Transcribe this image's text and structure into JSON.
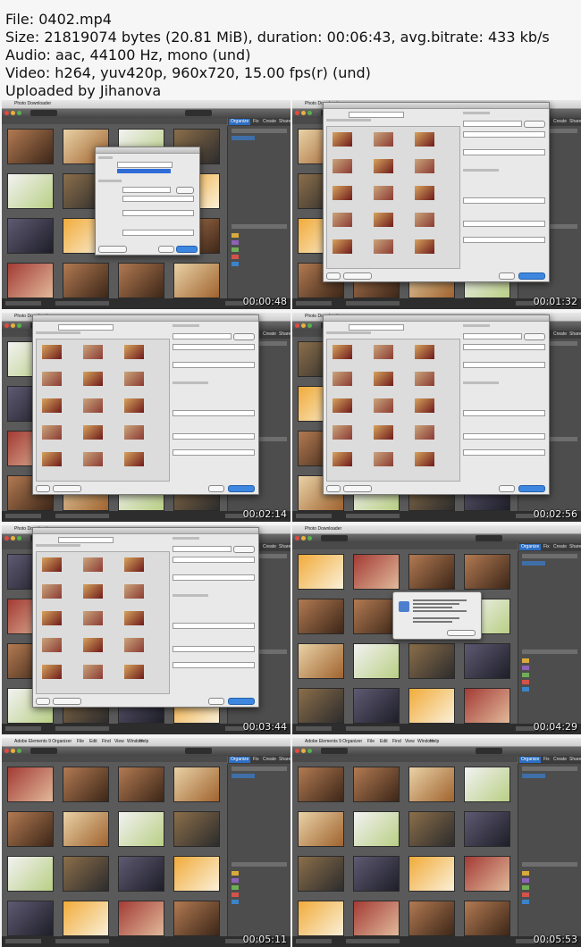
{
  "file_info": {
    "file_line": "File: 0402.mp4",
    "size_line": "Size: 21819074 bytes (20.81 MiB), duration: 00:06:43, avg.bitrate: 433 kb/s",
    "audio_line": "Audio: aac, 44100 Hz, mono (und)",
    "video_line": "Video: h264, yuv420p, 960x720, 15.00 fps(r) (und)",
    "uploader_line": "Uploaded by Jihanova"
  },
  "menu": {
    "photo_downloader": "Photo Downloader",
    "organizer_items": [
      "Adobe Elements 9 Organizer",
      "File",
      "Edit",
      "Find",
      "View",
      "Window",
      "Help"
    ]
  },
  "tabs": {
    "organize": "Organize",
    "fix": "Fix",
    "create": "Create",
    "share": "Share"
  },
  "frames": [
    {
      "timestamp": "00:00:48",
      "state": "download-options-dialog"
    },
    {
      "timestamp": "00:01:32",
      "state": "advanced-dialog"
    },
    {
      "timestamp": "00:02:14",
      "state": "advanced-dialog"
    },
    {
      "timestamp": "00:02:56",
      "state": "advanced-dialog"
    },
    {
      "timestamp": "00:03:44",
      "state": "advanced-dialog"
    },
    {
      "timestamp": "00:04:29",
      "state": "alert-dialog"
    },
    {
      "timestamp": "00:05:11",
      "state": "organizer-grid"
    },
    {
      "timestamp": "00:05:53",
      "state": "organizer-grid"
    }
  ]
}
